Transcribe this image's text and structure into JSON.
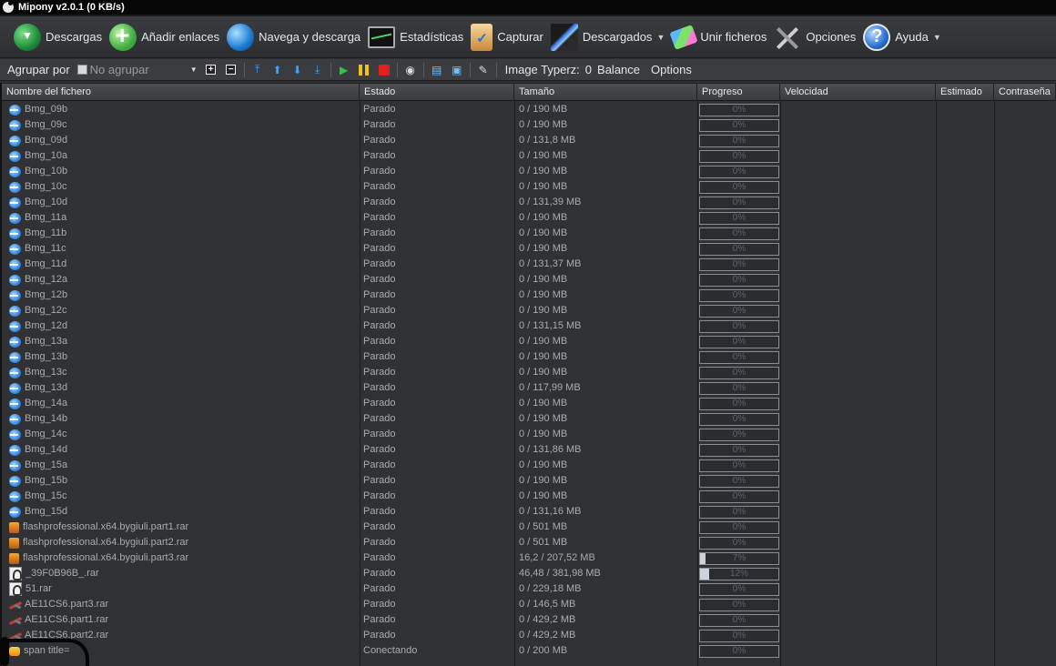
{
  "window": {
    "title": "Mipony v2.0.1 (0 KB/s)"
  },
  "main_toolbar": [
    {
      "label": "Descargas",
      "icon": "downloads-icon",
      "dropdown": false
    },
    {
      "label": "Añadir enlaces",
      "icon": "add-links-icon",
      "dropdown": false
    },
    {
      "label": "Navega y descarga",
      "icon": "globe-icon",
      "dropdown": false
    },
    {
      "label": "Estadísticas",
      "icon": "statistics-icon",
      "dropdown": false
    },
    {
      "label": "Capturar",
      "icon": "capture-icon",
      "dropdown": false
    },
    {
      "label": "Descargados",
      "icon": "downloaded-icon",
      "dropdown": true
    },
    {
      "label": "Unir ficheros",
      "icon": "join-files-icon",
      "dropdown": false
    },
    {
      "label": "Opciones",
      "icon": "options-icon",
      "dropdown": false
    },
    {
      "label": "Ayuda",
      "icon": "help-icon",
      "dropdown": true
    }
  ],
  "second_toolbar": {
    "group_label": "Agrupar por",
    "group_value": "No agrupar",
    "image_typerz_label": "Image Typerz:",
    "image_typerz_value": "0",
    "balance_label": "Balance",
    "options_label": "Options"
  },
  "table": {
    "columns": [
      "Nombre del fichero",
      "Estado",
      "Tamaño",
      "Progreso",
      "Velocidad",
      "Estimado",
      "Contraseña"
    ],
    "rows": [
      {
        "name": "Bmg_09b",
        "status": "Parado",
        "size": "0 / 190 MB",
        "progress": 0,
        "progress_label": "0%",
        "icon": "download-file-icon"
      },
      {
        "name": "Bmg_09c",
        "status": "Parado",
        "size": "0 / 190 MB",
        "progress": 0,
        "progress_label": "0%",
        "icon": "download-file-icon"
      },
      {
        "name": "Bmg_09d",
        "status": "Parado",
        "size": "0 / 131,8 MB",
        "progress": 0,
        "progress_label": "0%",
        "icon": "download-file-icon"
      },
      {
        "name": "Bmg_10a",
        "status": "Parado",
        "size": "0 / 190 MB",
        "progress": 0,
        "progress_label": "0%",
        "icon": "download-file-icon"
      },
      {
        "name": "Bmg_10b",
        "status": "Parado",
        "size": "0 / 190 MB",
        "progress": 0,
        "progress_label": "0%",
        "icon": "download-file-icon"
      },
      {
        "name": "Bmg_10c",
        "status": "Parado",
        "size": "0 / 190 MB",
        "progress": 0,
        "progress_label": "0%",
        "icon": "download-file-icon"
      },
      {
        "name": "Bmg_10d",
        "status": "Parado",
        "size": "0 / 131,39 MB",
        "progress": 0,
        "progress_label": "0%",
        "icon": "download-file-icon"
      },
      {
        "name": "Bmg_11a",
        "status": "Parado",
        "size": "0 / 190 MB",
        "progress": 0,
        "progress_label": "0%",
        "icon": "download-file-icon"
      },
      {
        "name": "Bmg_11b",
        "status": "Parado",
        "size": "0 / 190 MB",
        "progress": 0,
        "progress_label": "0%",
        "icon": "download-file-icon"
      },
      {
        "name": "Bmg_11c",
        "status": "Parado",
        "size": "0 / 190 MB",
        "progress": 0,
        "progress_label": "0%",
        "icon": "download-file-icon"
      },
      {
        "name": "Bmg_11d",
        "status": "Parado",
        "size": "0 / 131,37 MB",
        "progress": 0,
        "progress_label": "0%",
        "icon": "download-file-icon"
      },
      {
        "name": "Bmg_12a",
        "status": "Parado",
        "size": "0 / 190 MB",
        "progress": 0,
        "progress_label": "0%",
        "icon": "download-file-icon"
      },
      {
        "name": "Bmg_12b",
        "status": "Parado",
        "size": "0 / 190 MB",
        "progress": 0,
        "progress_label": "0%",
        "icon": "download-file-icon"
      },
      {
        "name": "Bmg_12c",
        "status": "Parado",
        "size": "0 / 190 MB",
        "progress": 0,
        "progress_label": "0%",
        "icon": "download-file-icon"
      },
      {
        "name": "Bmg_12d",
        "status": "Parado",
        "size": "0 / 131,15 MB",
        "progress": 0,
        "progress_label": "0%",
        "icon": "download-file-icon"
      },
      {
        "name": "Bmg_13a",
        "status": "Parado",
        "size": "0 / 190 MB",
        "progress": 0,
        "progress_label": "0%",
        "icon": "download-file-icon"
      },
      {
        "name": "Bmg_13b",
        "status": "Parado",
        "size": "0 / 190 MB",
        "progress": 0,
        "progress_label": "0%",
        "icon": "download-file-icon"
      },
      {
        "name": "Bmg_13c",
        "status": "Parado",
        "size": "0 / 190 MB",
        "progress": 0,
        "progress_label": "0%",
        "icon": "download-file-icon"
      },
      {
        "name": "Bmg_13d",
        "status": "Parado",
        "size": "0 / 117,99 MB",
        "progress": 0,
        "progress_label": "0%",
        "icon": "download-file-icon"
      },
      {
        "name": "Bmg_14a",
        "status": "Parado",
        "size": "0 / 190 MB",
        "progress": 0,
        "progress_label": "0%",
        "icon": "download-file-icon"
      },
      {
        "name": "Bmg_14b",
        "status": "Parado",
        "size": "0 / 190 MB",
        "progress": 0,
        "progress_label": "0%",
        "icon": "download-file-icon"
      },
      {
        "name": "Bmg_14c",
        "status": "Parado",
        "size": "0 / 190 MB",
        "progress": 0,
        "progress_label": "0%",
        "icon": "download-file-icon"
      },
      {
        "name": "Bmg_14d",
        "status": "Parado",
        "size": "0 / 131,86 MB",
        "progress": 0,
        "progress_label": "0%",
        "icon": "download-file-icon"
      },
      {
        "name": "Bmg_15a",
        "status": "Parado",
        "size": "0 / 190 MB",
        "progress": 0,
        "progress_label": "0%",
        "icon": "download-file-icon"
      },
      {
        "name": "Bmg_15b",
        "status": "Parado",
        "size": "0 / 190 MB",
        "progress": 0,
        "progress_label": "0%",
        "icon": "download-file-icon"
      },
      {
        "name": "Bmg_15c",
        "status": "Parado",
        "size": "0 / 190 MB",
        "progress": 0,
        "progress_label": "0%",
        "icon": "download-file-icon"
      },
      {
        "name": "Bmg_15d",
        "status": "Parado",
        "size": "0 / 131,16 MB",
        "progress": 0,
        "progress_label": "0%",
        "icon": "download-file-icon"
      },
      {
        "name": "flashprofessional.x64.bygiuli.part1.rar",
        "status": "Parado",
        "size": "0 / 501 MB",
        "progress": 0,
        "progress_label": "0%",
        "icon": "rar-file-icon"
      },
      {
        "name": "flashprofessional.x64.bygiuli.part2.rar",
        "status": "Parado",
        "size": "0 / 501 MB",
        "progress": 0,
        "progress_label": "0%",
        "icon": "rar-file-icon"
      },
      {
        "name": "flashprofessional.x64.bygiuli.part3.rar",
        "status": "Parado",
        "size": "16,2 / 207,52 MB",
        "progress": 7,
        "progress_label": "7%",
        "icon": "rar-file-icon"
      },
      {
        "name": "_39F0B96B_.rar",
        "status": "Parado",
        "size": "46,48 / 381,98 MB",
        "progress": 12,
        "progress_label": "12%",
        "icon": "image-file-icon"
      },
      {
        "name": "51.rar",
        "status": "Parado",
        "size": "0 / 229,18 MB",
        "progress": 0,
        "progress_label": "0%",
        "icon": "image-file-icon"
      },
      {
        "name": "AE11CS6.part3.rar",
        "status": "Parado",
        "size": "0 / 146,5 MB",
        "progress": 0,
        "progress_label": "0%",
        "icon": "tool-file-icon"
      },
      {
        "name": "AE11CS6.part1.rar",
        "status": "Parado",
        "size": "0 / 429,2 MB",
        "progress": 0,
        "progress_label": "0%",
        "icon": "tool-file-icon"
      },
      {
        "name": "AE11CS6.part2.rar",
        "status": "Parado",
        "size": "0 / 429,2 MB",
        "progress": 0,
        "progress_label": "0%",
        "icon": "tool-file-icon"
      },
      {
        "name": "span title=",
        "status": "Conectando",
        "size": "0 / 200 MB",
        "progress": 0,
        "progress_label": "0%",
        "icon": "connecting-file-icon"
      }
    ]
  }
}
